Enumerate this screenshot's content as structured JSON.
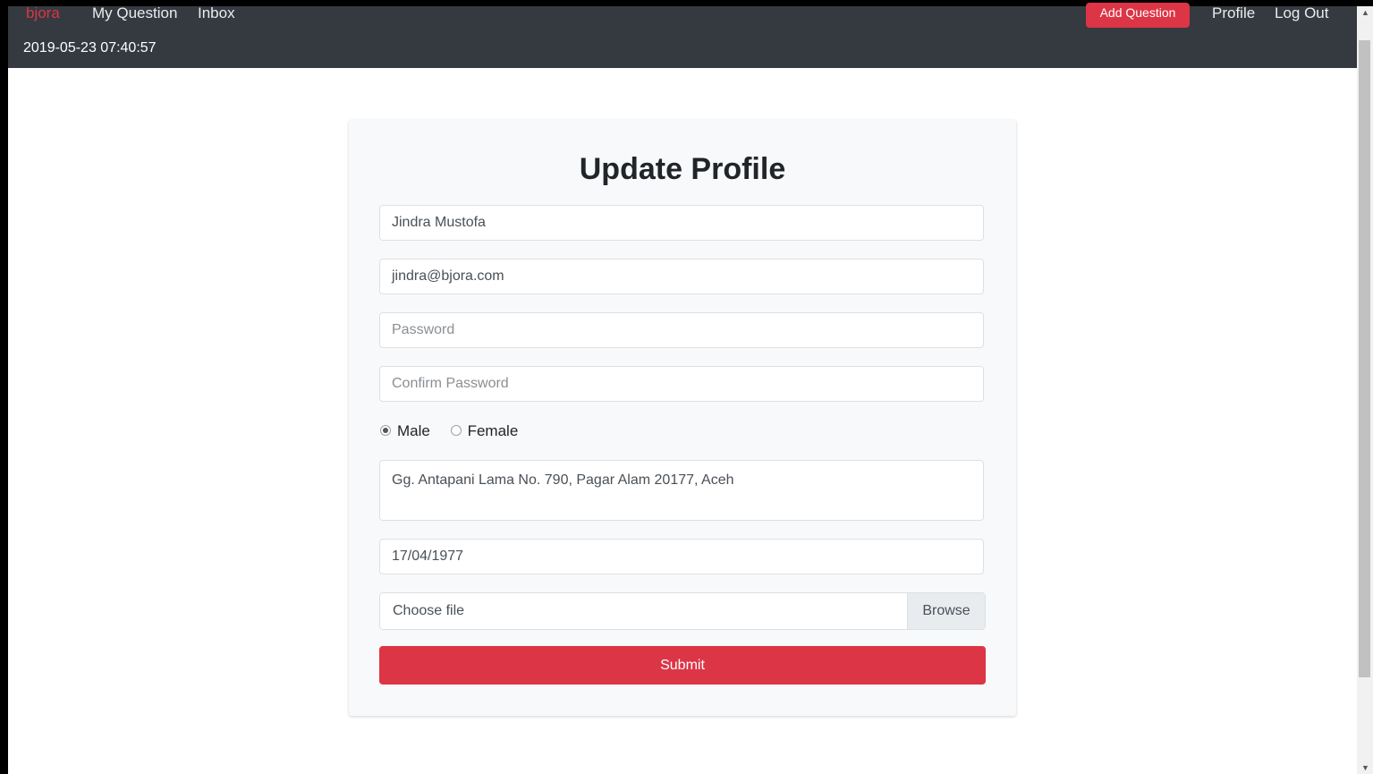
{
  "navbar": {
    "brand": "bjora",
    "links": [
      "My Question",
      "Inbox"
    ],
    "add_question": "Add Question",
    "profile": "Profile",
    "logout": "Log Out",
    "datetime": "2019-05-23 07:40:57"
  },
  "form": {
    "title": "Update Profile",
    "name_value": "Jindra Mustofa",
    "email_value": "jindra@bjora.com",
    "password_placeholder": "Password",
    "confirm_placeholder": "Confirm Password",
    "gender_options": [
      {
        "label": "Male",
        "selected": true
      },
      {
        "label": "Female",
        "selected": false
      }
    ],
    "address_value": "Gg. Antapani Lama No. 790, Pagar Alam 20177, Aceh",
    "dob_value": "17/04/1977",
    "file_label": "Choose file",
    "browse_label": "Browse",
    "submit_label": "Submit"
  },
  "colors": {
    "navbar_bg": "#343a40",
    "accent": "#dc3545",
    "card_bg": "#f8f9fa"
  }
}
